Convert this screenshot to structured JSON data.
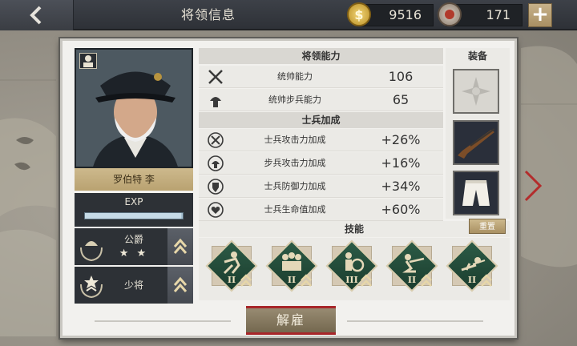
{
  "header": {
    "title": "将领信息",
    "back_icon": "chevron-left-icon",
    "gold_value": "9516",
    "medal_value": "171",
    "plus_label": "+"
  },
  "general": {
    "name": "罗伯特 李",
    "exp_label": "EXP",
    "exp_progress": 0.98,
    "ranks": [
      {
        "name": "公爵",
        "stars": "★ ★"
      },
      {
        "name": "少将",
        "stars": ""
      }
    ]
  },
  "stats": {
    "command_heading": "将领能力",
    "command": [
      {
        "label": "统帅能力",
        "value": "106",
        "icon": "crossed-swords-icon"
      },
      {
        "label": "统帅步兵能力",
        "value": "65",
        "icon": "infantry-helmet-icon"
      }
    ],
    "soldier_heading": "士兵加成",
    "soldier": [
      {
        "label": "士兵攻击力加成",
        "value": "+26%",
        "icon": "attack-bonus-icon"
      },
      {
        "label": "步兵攻击力加成",
        "value": "+16%",
        "icon": "infantry-attack-icon"
      },
      {
        "label": "士兵防御力加成",
        "value": "+34%",
        "icon": "shield-icon"
      },
      {
        "label": "士兵生命值加成",
        "value": "+60%",
        "icon": "heart-icon"
      }
    ]
  },
  "equipment": {
    "heading": "装备",
    "slots": [
      "medal-cross-icon",
      "rifle-icon",
      "trousers-icon"
    ]
  },
  "skills": {
    "heading": "技能",
    "reset_label": "重置",
    "items": [
      {
        "level": "II",
        "icon": "charging-soldier-icon"
      },
      {
        "level": "II",
        "icon": "infantry-squad-icon"
      },
      {
        "level": "III",
        "icon": "shielded-soldier-icon"
      },
      {
        "level": "II",
        "icon": "kneeling-rifleman-icon"
      },
      {
        "level": "II",
        "icon": "crawling-soldier-icon"
      }
    ]
  },
  "actions": {
    "dismiss_label": "解雇"
  },
  "colors": {
    "accent_gold": "#b9a271",
    "skill_green": "#2c5b46",
    "dismiss_red": "#a8262a"
  }
}
